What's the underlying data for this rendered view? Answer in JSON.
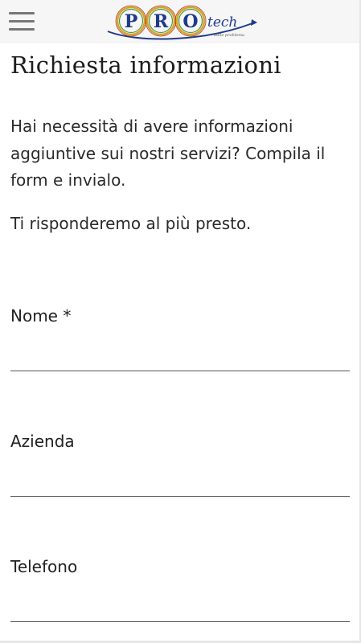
{
  "header": {
    "menu_icon": "hamburger-menu-icon",
    "logo": {
      "letters": [
        "P",
        "R",
        "O"
      ],
      "suffix": "tech",
      "tagline": "dalle problema"
    }
  },
  "page": {
    "title": "Richiesta informazioni",
    "intro": "Hai necessità di avere informazioni aggiuntive sui nostri servizi? Compila il form e invialo.",
    "intro2": "Ti risponderemo al più presto."
  },
  "form": {
    "fields": [
      {
        "label": "Nome *",
        "value": ""
      },
      {
        "label": "Azienda",
        "value": ""
      },
      {
        "label": "Telefono",
        "value": ""
      }
    ]
  },
  "colors": {
    "logo_blue": "#1f3a8a",
    "logo_ring_gold": "#d4a52c",
    "logo_ring_green": "#4f9a3c",
    "logo_ring_red": "#c0392b",
    "header_bg": "#f6f6f6"
  }
}
